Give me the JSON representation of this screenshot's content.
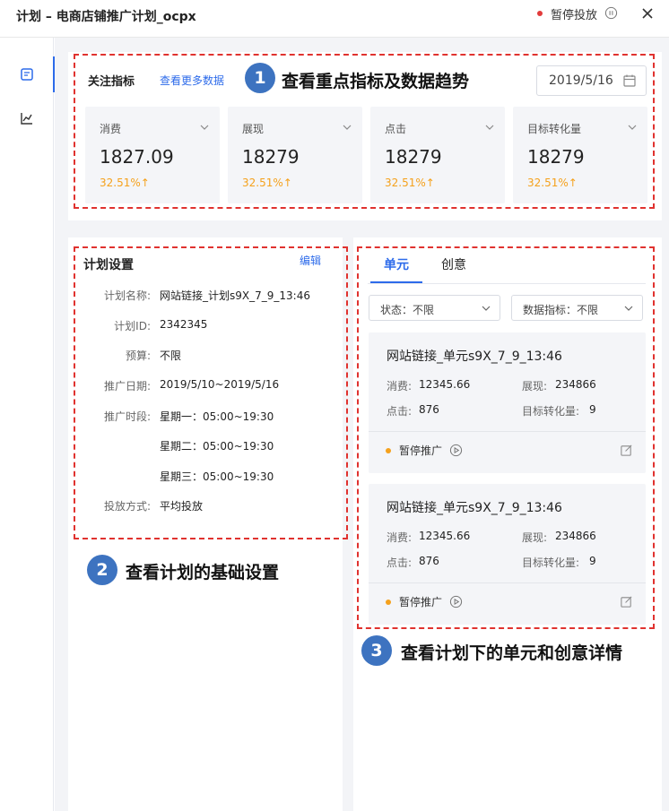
{
  "window": {
    "title": "计划 – 电商店铺推广计划_ocpx",
    "status": "暂停投放",
    "status_color": "#e23b3b"
  },
  "sidebar": {
    "items": [
      {
        "icon": "document-icon",
        "active": true
      },
      {
        "icon": "chart-icon",
        "active": false
      }
    ]
  },
  "metrics": {
    "label": "关注指标",
    "more_link": "查看更多数据",
    "date": "2019/5/16",
    "cards": [
      {
        "name": "消费",
        "value": "1827.09",
        "delta": "32.51%↑"
      },
      {
        "name": "展现",
        "value": "18279",
        "delta": "32.51%↑"
      },
      {
        "name": "点击",
        "value": "18279",
        "delta": "32.51%↑"
      },
      {
        "name": "目标转化量",
        "value": "18279",
        "delta": "32.51%↑"
      }
    ]
  },
  "plan": {
    "title": "计划设置",
    "edit": "编辑",
    "fields": [
      {
        "label": "计划名称:",
        "value": "网站链接_计划s9X_7_9_13:46"
      },
      {
        "label": "计划ID:",
        "value": "2342345"
      },
      {
        "label": "预算:",
        "value": "不限"
      },
      {
        "label": "推广日期:",
        "value": "2019/5/10~2019/5/16"
      },
      {
        "label": "推广时段:",
        "value": "星期一：05:00~19:30"
      },
      {
        "label": "",
        "value": "星期二：05:00~19:30"
      },
      {
        "label": "",
        "value": "星期三：05:00~19:30"
      },
      {
        "label": "投放方式:",
        "value": "平均投放"
      }
    ]
  },
  "units": {
    "tabs": [
      "单元",
      "创意"
    ],
    "filters": [
      "状态：不限",
      "数据指标：不限"
    ],
    "cards": [
      {
        "title": "网站链接_单元s9X_7_9_13:46",
        "spend_label": "消费:",
        "spend": "12345.66",
        "impressions_label": "展现:",
        "impressions": "234866",
        "clicks_label": "点击:",
        "clicks": "876",
        "conversions_label": "目标转化量:",
        "conversions": "9",
        "status": "暂停推广"
      },
      {
        "title": "网站链接_单元s9X_7_9_13:46",
        "spend_label": "消费:",
        "spend": "12345.66",
        "impressions_label": "展现:",
        "impressions": "234866",
        "clicks_label": "点击:",
        "clicks": "876",
        "conversions_label": "目标转化量:",
        "conversions": "9",
        "status": "暂停推广"
      }
    ]
  },
  "annotations": [
    {
      "number": "1",
      "text": "查看重点指标及数据趋势"
    },
    {
      "number": "2",
      "text": "查看计划的基础设置"
    },
    {
      "number": "3",
      "text": "查看计划下的单元和创意详情"
    }
  ],
  "colors": {
    "accent": "#2d6bea",
    "annotation_red": "#e0322f",
    "badge_blue": "#3d73c0",
    "delta_orange": "#f5a11c"
  }
}
